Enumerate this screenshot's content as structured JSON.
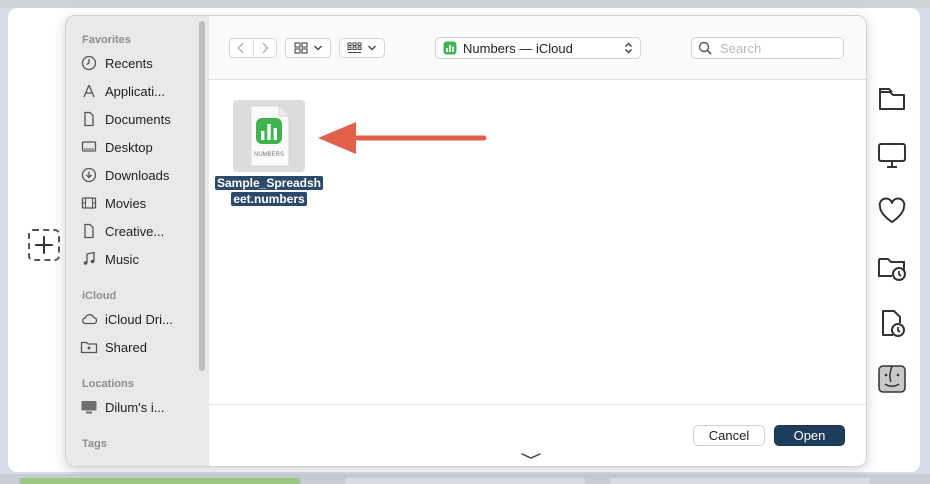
{
  "sidebar": {
    "sections": [
      {
        "title": "Favorites",
        "items": [
          {
            "label": "Recents",
            "icon": "clock-icon"
          },
          {
            "label": "Applicati...",
            "icon": "applications-icon"
          },
          {
            "label": "Documents",
            "icon": "document-icon"
          },
          {
            "label": "Desktop",
            "icon": "desktop-icon"
          },
          {
            "label": "Downloads",
            "icon": "download-icon"
          },
          {
            "label": "Movies",
            "icon": "film-icon"
          },
          {
            "label": "Creative...",
            "icon": "document-icon"
          },
          {
            "label": "Music",
            "icon": "music-note-icon"
          }
        ]
      },
      {
        "title": "iCloud",
        "items": [
          {
            "label": "iCloud Dri...",
            "icon": "cloud-icon"
          },
          {
            "label": "Shared",
            "icon": "shared-folder-icon"
          }
        ]
      },
      {
        "title": "Locations",
        "items": [
          {
            "label": "Dilum's i...",
            "icon": "computer-icon"
          }
        ]
      },
      {
        "title": "Tags",
        "items": []
      }
    ]
  },
  "toolbar": {
    "location": "Numbers — iCloud",
    "search_placeholder": "Search"
  },
  "files": [
    {
      "name_line1": "Sample_Spreadsh",
      "name_line2": "eet.numbers",
      "badge": "NUMBERS",
      "selected": true
    }
  ],
  "footer": {
    "cancel_label": "Cancel",
    "open_label": "Open"
  },
  "colors": {
    "accent": "#1e3c5c",
    "selection": "#2b4a6b",
    "numbers_green": "#3fb34f",
    "annotation_arrow": "#e0604c"
  }
}
